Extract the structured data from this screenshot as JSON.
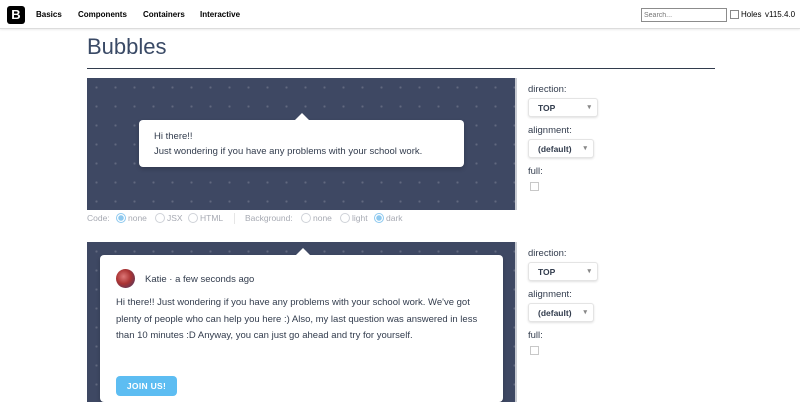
{
  "header": {
    "logo": "B",
    "nav": [
      "Basics",
      "Components",
      "Containers",
      "Interactive"
    ],
    "search_placeholder": "Search...",
    "holes_label": "Holes",
    "version": "v115.4.0"
  },
  "page": {
    "title": "Bubbles"
  },
  "example1": {
    "bubble_lines": [
      "Hi there!!",
      "Just wondering if you have any problems with your school work."
    ],
    "options": {
      "direction_label": "direction:",
      "direction_value": "TOP",
      "alignment_label": "alignment:",
      "alignment_value": "(default)",
      "full_label": "full:"
    },
    "code_bar": {
      "code_label": "Code:",
      "code_options": [
        "none",
        "JSX",
        "HTML"
      ],
      "code_selected": "none",
      "background_label": "Background:",
      "background_options": [
        "none",
        "light",
        "dark"
      ],
      "background_selected": "dark"
    }
  },
  "example2": {
    "author": "Katie",
    "time": "a few seconds ago",
    "separator": "·",
    "message": "Hi there!! Just wondering if you have any problems with your school work. We've got plenty of people who can help you here :) Also, my last question was answered in less than 10 minutes :D Anyway, you can just go ahead and try for yourself.",
    "button_label": "JOIN US!",
    "options": {
      "direction_label": "direction:",
      "direction_value": "TOP",
      "alignment_label": "alignment:",
      "alignment_value": "(default)",
      "full_label": "full:"
    }
  },
  "icons": {
    "select_arrow": "▾"
  },
  "colors": {
    "stage_bg": "#3e4863",
    "accent": "#5dbdf2",
    "text": "#323c4d"
  }
}
